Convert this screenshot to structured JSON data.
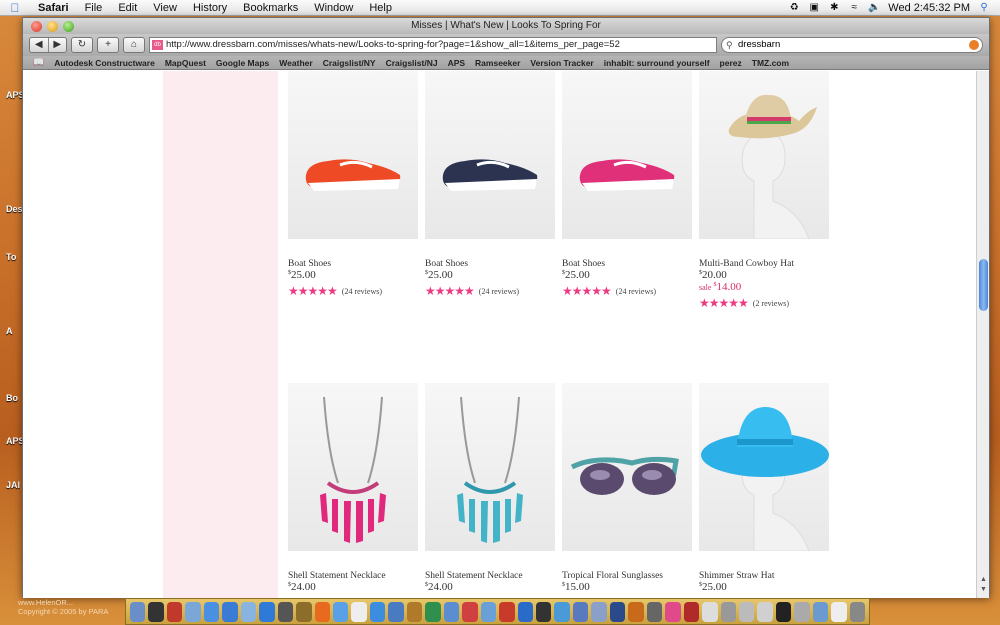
{
  "menubar": {
    "app": "Safari",
    "items": [
      "File",
      "Edit",
      "View",
      "History",
      "Bookmarks",
      "Window",
      "Help"
    ],
    "clock": "Wed 2:45:32 PM"
  },
  "window": {
    "title": "Misses | What's New | Looks To Spring For",
    "url": "http://www.dressbarn.com/misses/whats-new/Looks-to-spring-for?page=1&show_all=1&items_per_page=52",
    "search_value": "dressbarn"
  },
  "bookmarks": [
    "Autodesk Constructware",
    "MapQuest",
    "Google Maps",
    "Weather",
    "Craigslist/NY",
    "Craigslist/NJ",
    "APS",
    "Ramseeker",
    "Version Tracker",
    "inhabit: surround yourself",
    "perez",
    "TMZ.com"
  ],
  "desktop_labels": [
    "APS",
    "Des",
    "To",
    "A",
    "Bo",
    "APS",
    "JAI"
  ],
  "products": [
    {
      "name": "Boat Shoes",
      "price_symbol": "$",
      "price": "25.00",
      "sale": "",
      "sale_price": "",
      "reviews": "(24 reviews)",
      "stars": 4.5,
      "img": "boat-shoe-orange",
      "color": "#ee4a26"
    },
    {
      "name": "Boat Shoes",
      "price_symbol": "$",
      "price": "25.00",
      "sale": "",
      "sale_price": "",
      "reviews": "(24 reviews)",
      "stars": 4.5,
      "img": "boat-shoe-navy",
      "color": "#2c3350"
    },
    {
      "name": "Boat Shoes",
      "price_symbol": "$",
      "price": "25.00",
      "sale": "",
      "sale_price": "",
      "reviews": "(24 reviews)",
      "stars": 4.5,
      "img": "boat-shoe-pink",
      "color": "#e0307a"
    },
    {
      "name": "Multi-Band Cowboy Hat",
      "price_symbol": "$",
      "price": "20.00",
      "sale": "sale",
      "sale_price": "14.00",
      "reviews": "(2 reviews)",
      "stars": 5,
      "img": "cowboy-hat",
      "color": "#dcc79a"
    },
    {
      "name": "Shell Statement Necklace",
      "price_symbol": "$",
      "price": "24.00",
      "img": "necklace-pink",
      "color": "#e0287d"
    },
    {
      "name": "Shell Statement Necklace",
      "price_symbol": "$",
      "price": "24.00",
      "img": "necklace-teal",
      "color": "#43b3c8"
    },
    {
      "name": "Tropical Floral Sunglasses",
      "price_symbol": "$",
      "price": "15.00",
      "img": "sunglasses",
      "color": "#4fa3a6"
    },
    {
      "name": "Shimmer Straw Hat",
      "price_symbol": "$",
      "price": "25.00",
      "img": "straw-hat-blue",
      "color": "#2cb0e8"
    }
  ],
  "footer": {
    "line1": "www.HelenOR...",
    "line2": "Copyright © 2005 by PARA"
  }
}
